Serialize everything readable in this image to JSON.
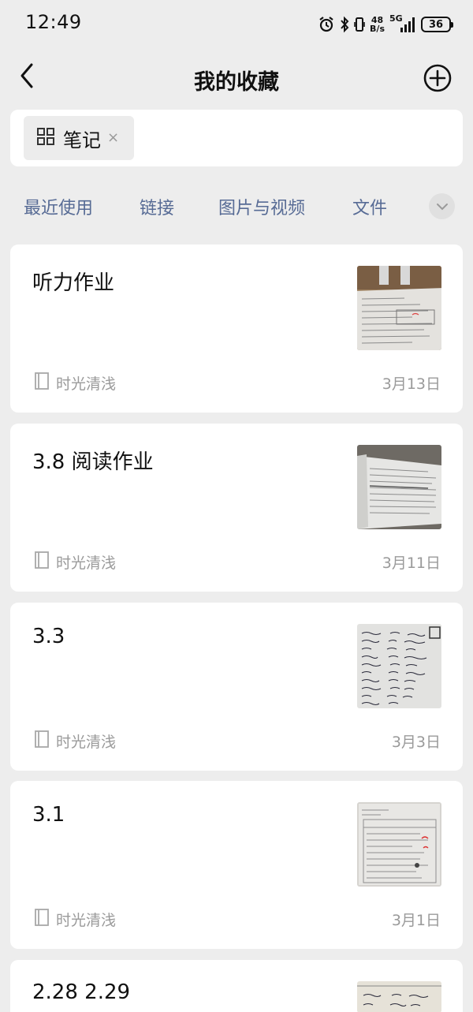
{
  "status": {
    "time": "12:49",
    "net_speed_value": "48",
    "net_speed_unit": "B/s",
    "network": "5G",
    "battery": "36"
  },
  "nav": {
    "title": "我的收藏"
  },
  "filter": {
    "chip_label": "笔记",
    "chip_close": "×"
  },
  "tabs": [
    "最近使用",
    "链接",
    "图片与视频",
    "文件"
  ],
  "notes": [
    {
      "title": "听力作业",
      "source": "时光清浅",
      "date": "3月13日"
    },
    {
      "title": "3.8 阅读作业",
      "source": "时光清浅",
      "date": "3月11日"
    },
    {
      "title": "3.3",
      "source": "时光清浅",
      "date": "3月3日"
    },
    {
      "title": "3.1",
      "source": "时光清浅",
      "date": "3月1日"
    },
    {
      "title": "2.28  2.29",
      "source": "",
      "date": ""
    }
  ],
  "colors": {
    "background": "#ededed",
    "card": "#ffffff",
    "tab_link": "#576b95",
    "meta_gray": "#9a9a9a"
  }
}
